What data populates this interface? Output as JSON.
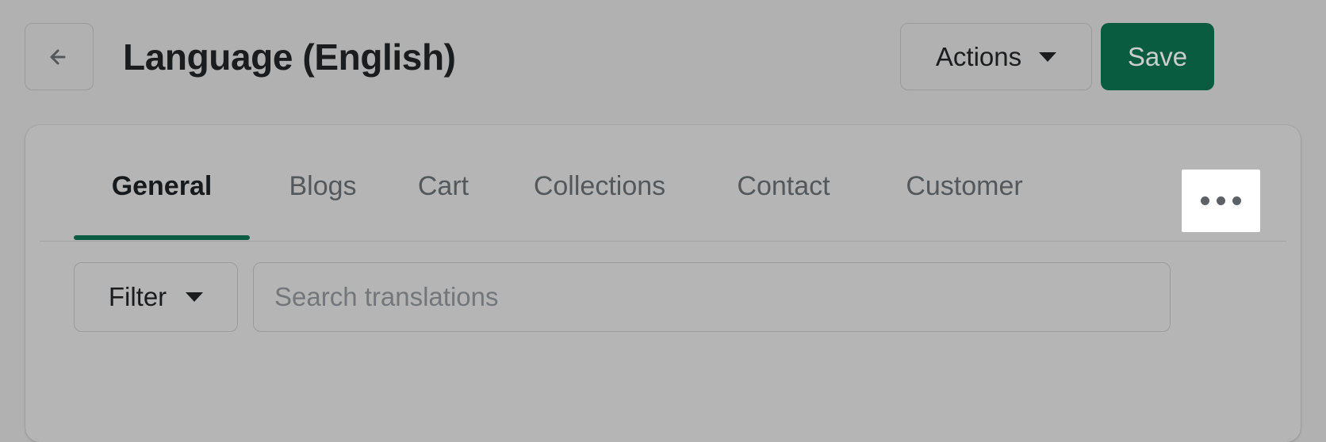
{
  "header": {
    "back_icon": "arrow-left-icon",
    "title": "Language (English)",
    "actions_label": "Actions",
    "actions_caret_icon": "chevron-down-icon",
    "save_label": "Save"
  },
  "card": {
    "tabs": [
      {
        "label": "General",
        "active": true
      },
      {
        "label": "Blogs",
        "active": false
      },
      {
        "label": "Cart",
        "active": false
      },
      {
        "label": "Collections",
        "active": false
      },
      {
        "label": "Contact",
        "active": false
      },
      {
        "label": "Customer",
        "active": false
      }
    ],
    "more_tabs_icon": "ellipsis-horizontal-icon",
    "filter": {
      "label": "Filter",
      "caret_icon": "chevron-down-icon"
    },
    "search": {
      "placeholder": "Search translations",
      "value": ""
    }
  },
  "colors": {
    "page_background": "#b1b1b1",
    "card_background": "#b5b5b5",
    "primary_action": "#0a5c41",
    "active_tab_underline": "#0b5c42",
    "text_primary": "#1a1c1d",
    "text_muted": "#53585d",
    "more_button_background": "#ffffff"
  }
}
